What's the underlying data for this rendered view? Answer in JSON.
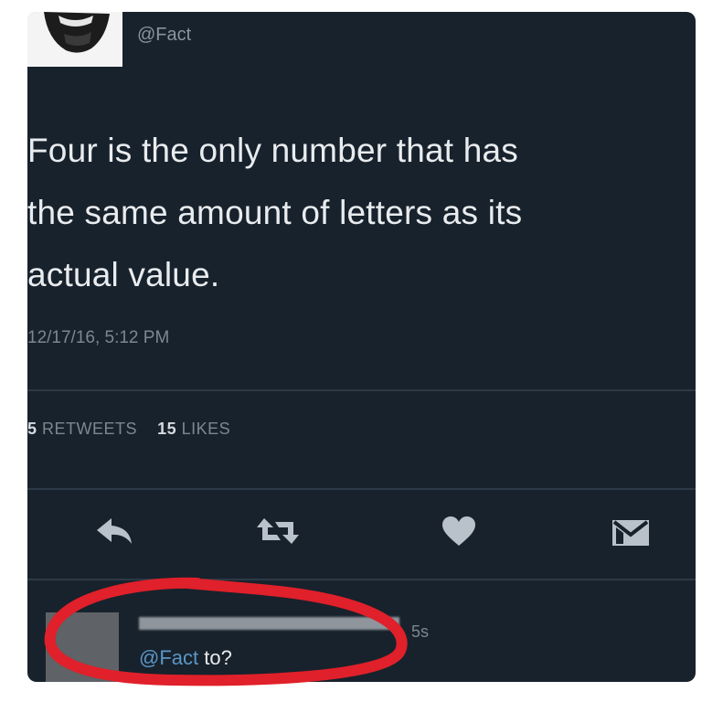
{
  "tweet": {
    "handle": "@Fact",
    "text_lines": [
      "Four is the only number that has",
      "the same amount of letters as its",
      "actual value."
    ],
    "timestamp": "12/17/16, 5:12 PM",
    "retweets_count": "5",
    "retweets_label": "RETWEETS",
    "likes_count": "15",
    "likes_label": "LIKES"
  },
  "actions": {
    "reply": "reply-icon",
    "retweet": "retweet-icon",
    "like": "heart-icon",
    "message": "envelope-icon"
  },
  "reply": {
    "time": "5s",
    "mention": "@Fact",
    "text": " to?"
  },
  "colors": {
    "card_bg": "#18222c",
    "text": "#e9ecef",
    "muted": "#7d8790",
    "link": "#5a96c7",
    "highlight_circle": "#e0202a"
  }
}
